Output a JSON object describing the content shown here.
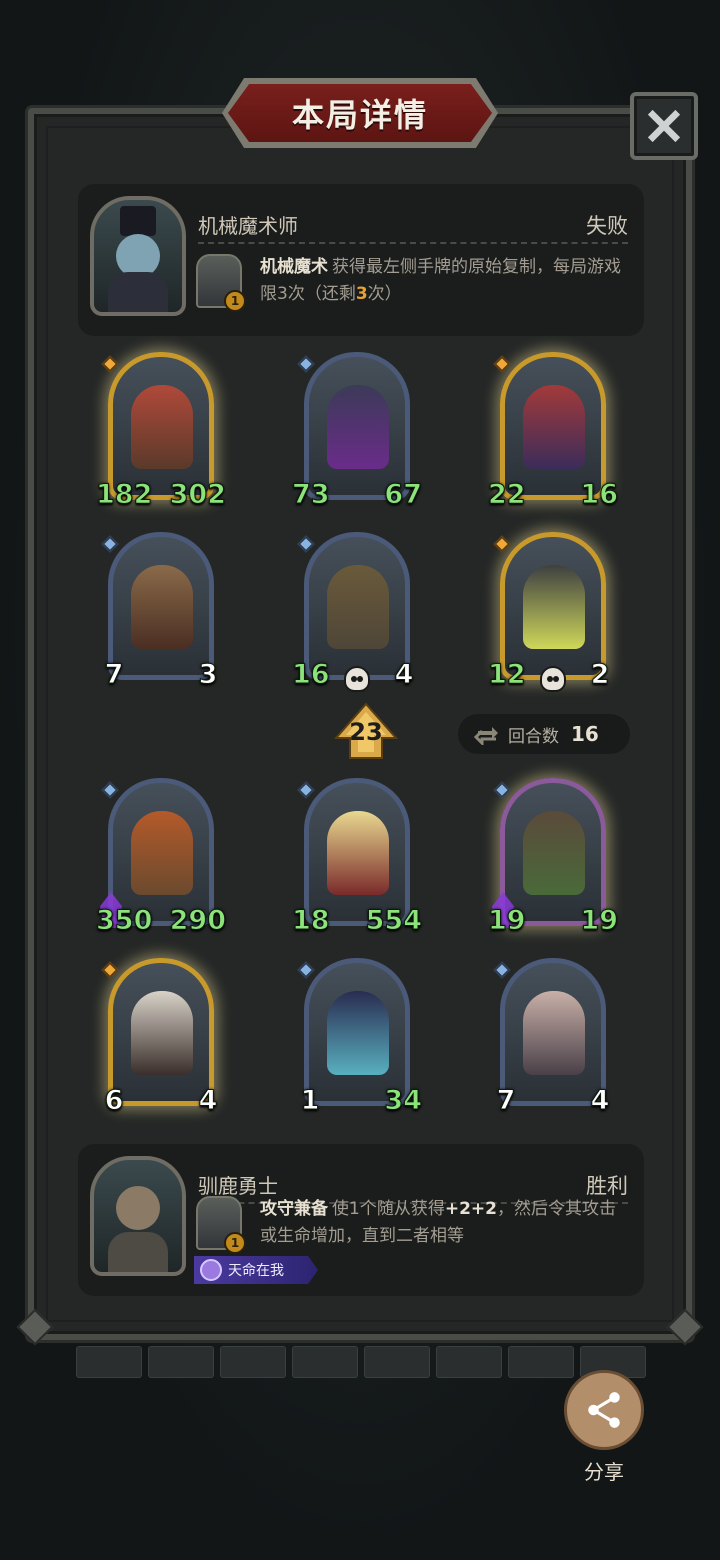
{
  "header": {
    "title": "本局详情"
  },
  "opponent": {
    "name": "机械魔术师",
    "result": "失败",
    "skill_level": "1",
    "skill_name": "机械魔术",
    "skill_desc_1": "获得最左侧手牌的原始复制，每局游戏限3次（还剩",
    "skill_remaining": "3",
    "skill_desc_2": "次）"
  },
  "opponent_board": [
    {
      "attack": "182",
      "health": "302",
      "attack_buffed": true,
      "health_buffed": true,
      "frame": "gold"
    },
    {
      "attack": "73",
      "health": "67",
      "attack_buffed": true,
      "health_buffed": true,
      "frame": "blue"
    },
    {
      "attack": "22",
      "health": "16",
      "attack_buffed": true,
      "health_buffed": true,
      "frame": "gold"
    },
    {
      "attack": "7",
      "health": "3",
      "attack_buffed": false,
      "health_buffed": false,
      "frame": "blue"
    },
    {
      "attack": "16",
      "health": "4",
      "attack_buffed": true,
      "health_buffed": false,
      "frame": "blue",
      "skull": true
    },
    {
      "attack": "12",
      "health": "2",
      "attack_buffed": true,
      "health_buffed": false,
      "frame": "gold",
      "skull": true
    }
  ],
  "middle": {
    "tier": "23",
    "turn_label": "回合数",
    "turn_value": "16"
  },
  "player_board": [
    {
      "attack": "350",
      "health": "290",
      "attack_buffed": true,
      "health_buffed": true,
      "frame": "blue",
      "poison": true
    },
    {
      "attack": "18",
      "health": "554",
      "attack_buffed": true,
      "health_buffed": true,
      "frame": "blue"
    },
    {
      "attack": "19",
      "health": "19",
      "attack_buffed": true,
      "health_buffed": true,
      "frame": "purple",
      "poison": true
    },
    {
      "attack": "6",
      "health": "4",
      "attack_buffed": false,
      "health_buffed": false,
      "frame": "gold"
    },
    {
      "attack": "1",
      "health": "34",
      "attack_buffed": false,
      "health_buffed": true,
      "frame": "blue"
    },
    {
      "attack": "7",
      "health": "4",
      "attack_buffed": false,
      "health_buffed": false,
      "frame": "blue"
    }
  ],
  "player": {
    "name": "驯鹿勇士",
    "result": "胜利",
    "skill_level": "1",
    "skill_name": "攻守兼备",
    "skill_desc_1": "使1个随从获得",
    "skill_bonus": "+2+2",
    "skill_desc_2": "，然后令其攻击或生命增加，直到二者相等",
    "trait": "天命在我"
  },
  "share": {
    "label": "分享"
  },
  "colors": {
    "buff_green": "#8be37a",
    "highlight_orange": "#e8a030",
    "banner_red": "#7a1f1c"
  }
}
